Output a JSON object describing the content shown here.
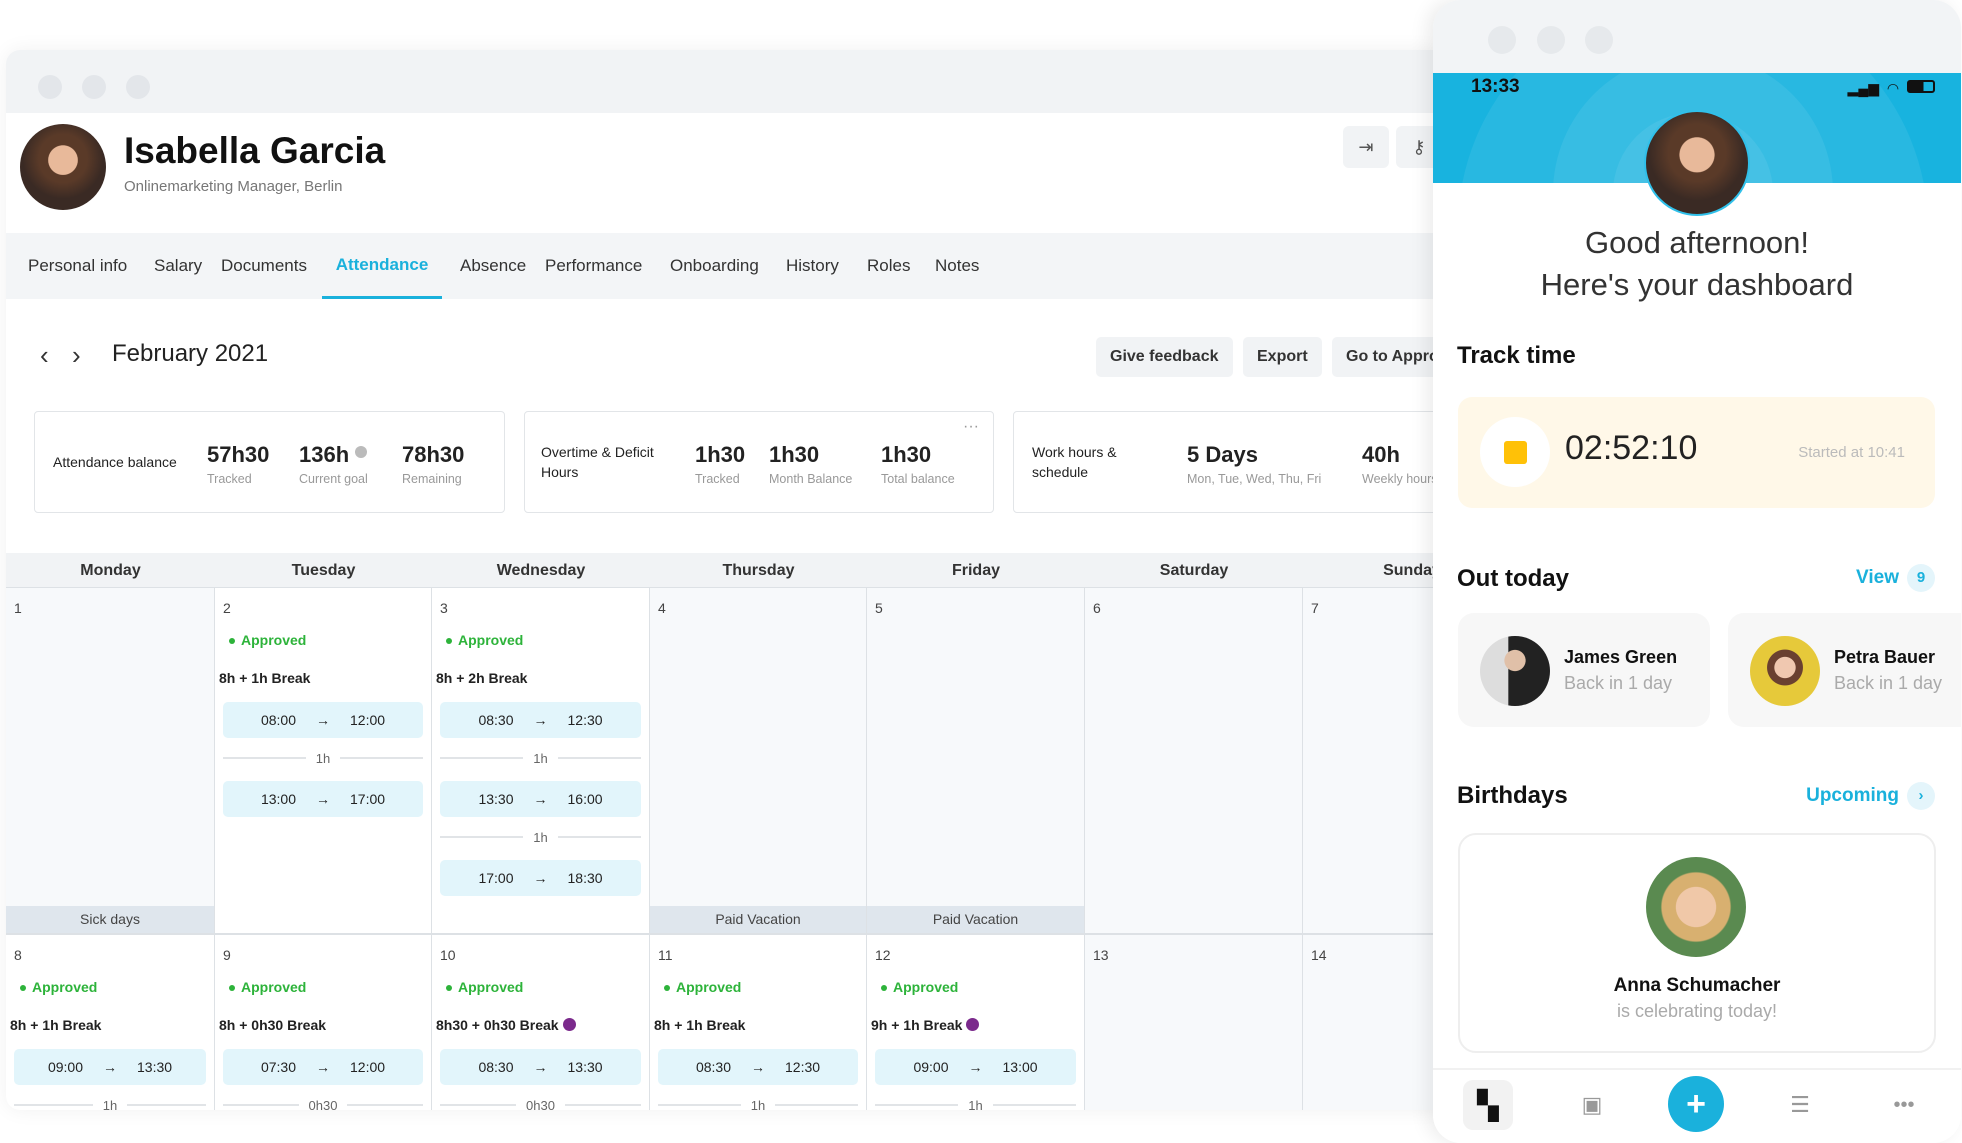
{
  "profile": {
    "name": "Isabella Garcia",
    "subtitle": "Onlinemarketing Manager, Berlin"
  },
  "header_icons": [
    "login-icon",
    "key-icon"
  ],
  "tabs": [
    {
      "label": "Personal info"
    },
    {
      "label": "Salary"
    },
    {
      "label": "Documents"
    },
    {
      "label": "Attendance",
      "active": true
    },
    {
      "label": "Absence"
    },
    {
      "label": "Performance"
    },
    {
      "label": "Onboarding"
    },
    {
      "label": "History"
    },
    {
      "label": "Roles"
    },
    {
      "label": "Notes"
    }
  ],
  "month": {
    "label": "February 2021"
  },
  "actions": {
    "feedback": "Give feedback",
    "export": "Export",
    "approvals": "Go to Appro"
  },
  "cards": {
    "attendance": {
      "title": "Attendance balance",
      "tracked": "57h30",
      "tracked_label": "Tracked",
      "goal": "136h",
      "goal_label": "Current goal",
      "remaining": "78h30",
      "remaining_label": "Remaining"
    },
    "overtime": {
      "title": "Overtime & Deficit Hours",
      "tracked": "1h30",
      "tracked_label": "Tracked",
      "month": "1h30",
      "month_label": "Month Balance",
      "total": "1h30",
      "total_label": "Total balance",
      "menu": "···"
    },
    "schedule": {
      "title": "Work hours & schedule",
      "days": "5 Days",
      "days_label": "Mon, Tue, Wed, Thu, Fri",
      "weekly": "40h",
      "weekly_label": "Weekly hours"
    }
  },
  "calendar": {
    "days": [
      "Monday",
      "Tuesday",
      "Wednesday",
      "Thursday",
      "Friday",
      "Saturday",
      "Sunday"
    ],
    "weeks": [
      [
        {
          "day": "1",
          "off": true,
          "footer": "Sick days"
        },
        {
          "day": "2",
          "status": "Approved",
          "summary": "8h + 1h Break",
          "segments": [
            {
              "start": "08:00",
              "end": "12:00"
            },
            {
              "start": "13:00",
              "end": "17:00"
            }
          ],
          "breaks": [
            "1h"
          ]
        },
        {
          "day": "3",
          "status": "Approved",
          "summary": "8h + 2h Break",
          "segments": [
            {
              "start": "08:30",
              "end": "12:30"
            },
            {
              "start": "13:30",
              "end": "16:00"
            },
            {
              "start": "17:00",
              "end": "18:30"
            }
          ],
          "breaks": [
            "1h",
            "1h"
          ]
        },
        {
          "day": "4",
          "off": true,
          "footer": "Paid Vacation"
        },
        {
          "day": "5",
          "off": true,
          "footer": "Paid Vacation"
        },
        {
          "day": "6",
          "off": true
        },
        {
          "day": "7",
          "off": true
        }
      ],
      [
        {
          "day": "8",
          "status": "Approved",
          "summary": "8h + 1h Break",
          "segments": [
            {
              "start": "09:00",
              "end": "13:30"
            }
          ],
          "breaks": [
            "1h"
          ]
        },
        {
          "day": "9",
          "status": "Approved",
          "summary": "8h + 0h30 Break",
          "segments": [
            {
              "start": "07:30",
              "end": "12:00"
            }
          ],
          "breaks": [
            "0h30"
          ]
        },
        {
          "day": "10",
          "status": "Approved",
          "summary": "8h30 + 0h30 Break",
          "clock": true,
          "segments": [
            {
              "start": "08:30",
              "end": "13:30"
            }
          ],
          "breaks": [
            "0h30"
          ]
        },
        {
          "day": "11",
          "status": "Approved",
          "summary": "8h + 1h Break",
          "segments": [
            {
              "start": "08:30",
              "end": "12:30"
            }
          ],
          "breaks": [
            "1h"
          ]
        },
        {
          "day": "12",
          "status": "Approved",
          "summary": "9h + 1h Break",
          "clock": true,
          "segments": [
            {
              "start": "09:00",
              "end": "13:00"
            }
          ],
          "breaks": [
            "1h"
          ]
        },
        {
          "day": "13",
          "off": true
        },
        {
          "day": "14",
          "off": true
        }
      ]
    ],
    "arrow": "→"
  },
  "phone": {
    "time": "13:33",
    "greeting1": "Good afternoon!",
    "greeting2": "Here's your dashboard",
    "track": {
      "title": "Track time",
      "timer": "02:52:10",
      "started": "Started at 10:41",
      "accent": "#ffc107"
    },
    "out": {
      "title": "Out today",
      "view": "View",
      "count": "9",
      "people": [
        {
          "name": "James Green",
          "status": "Back in 1 day"
        },
        {
          "name": "Petra Bauer",
          "status": "Back in 1 day"
        }
      ]
    },
    "birthdays": {
      "title": "Birthdays",
      "link": "Upcoming",
      "name": "Anna Schumacher",
      "text": "is celebrating today!"
    },
    "nav": [
      "dashboard-icon",
      "calendar-icon",
      "add-icon",
      "people-list-icon",
      "more-icon"
    ]
  },
  "colors": {
    "accent": "#1ab1dc",
    "approved": "#2db33a",
    "header_blue": "#18b3df"
  }
}
